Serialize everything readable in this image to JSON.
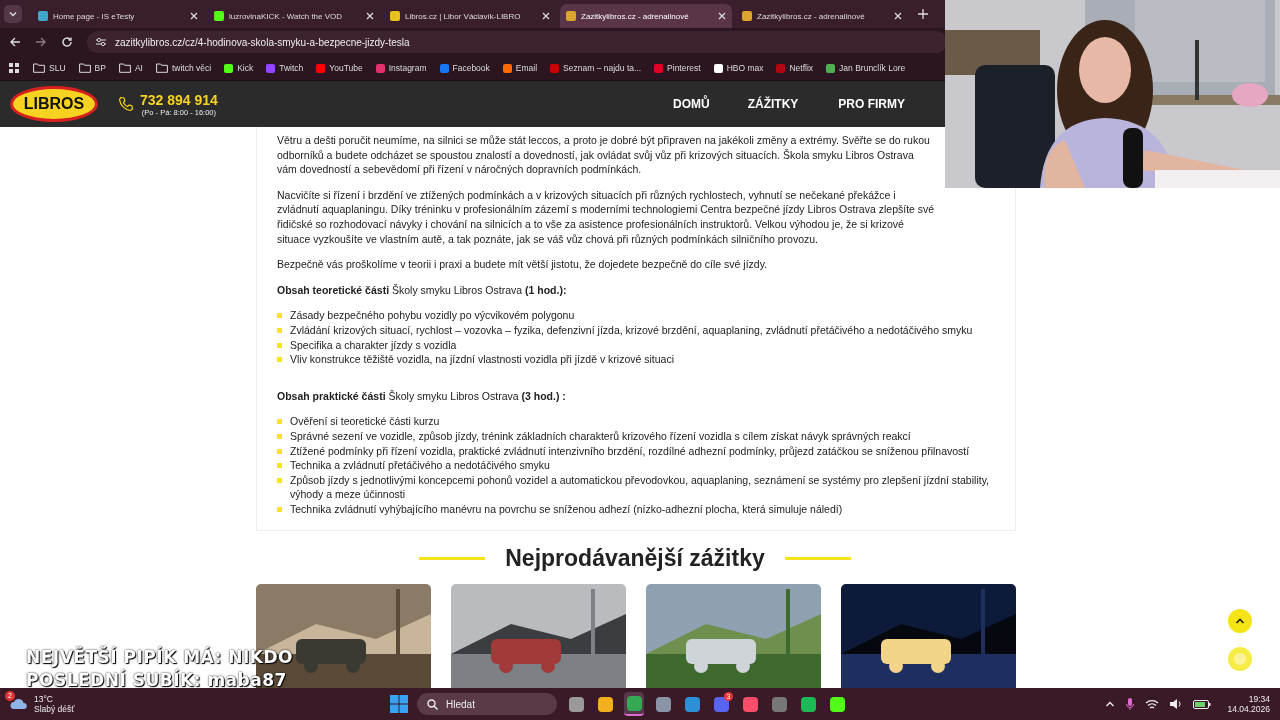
{
  "tabs": [
    {
      "title": "Home page - IS eTesty",
      "selected": false,
      "color": "#3fa7c9"
    },
    {
      "title": "luzrovinaKICK - Watch the VOD",
      "selected": false,
      "color": "#53fc18"
    },
    {
      "title": "Libros.cz | Libor Václavík-LIBRO",
      "selected": false,
      "color": "#e8c21c"
    },
    {
      "title": "Zazitkylibros.cz - adrenalinové",
      "selected": true,
      "color": "#d9a52a"
    },
    {
      "title": "Zazitkylibros.cz - adrenalinové",
      "selected": false,
      "color": "#d9a52a"
    }
  ],
  "address": {
    "url": "zazitkylibros.cz/cz/4-hodinova-skola-smyku-a-bezpecne-jizdy-tesla"
  },
  "bookmarks": [
    {
      "label": "SLU",
      "kind": "folder"
    },
    {
      "label": "BP",
      "kind": "folder"
    },
    {
      "label": "AI",
      "kind": "folder"
    },
    {
      "label": "twitch věci",
      "kind": "folder"
    },
    {
      "label": "Kick",
      "kind": "site",
      "color": "#53fc18"
    },
    {
      "label": "Twitch",
      "kind": "site",
      "color": "#9146ff"
    },
    {
      "label": "YouTube",
      "kind": "site",
      "color": "#ff0000"
    },
    {
      "label": "Instagram",
      "kind": "site",
      "color": "#e1306c"
    },
    {
      "label": "Facebook",
      "kind": "site",
      "color": "#1877f2"
    },
    {
      "label": "Email",
      "kind": "site",
      "color": "#ff6a00"
    },
    {
      "label": "Seznam – najdu ta...",
      "kind": "site",
      "color": "#cc0000"
    },
    {
      "label": "Pinterest",
      "kind": "site",
      "color": "#e60023"
    },
    {
      "label": "HBO max",
      "kind": "site",
      "color": "#ffffff"
    },
    {
      "label": "Netflix",
      "kind": "site",
      "color": "#b20710"
    },
    {
      "label": "Jan Brunclík Lore",
      "kind": "site",
      "color": "#4caf50"
    }
  ],
  "header": {
    "logo": "LIBROS",
    "phone": "732 894 914",
    "hours": "(Po - Pá: 8:00 - 16:00)",
    "nav": [
      "DOMŮ",
      "ZÁŽITKY",
      "PRO FIRMY"
    ]
  },
  "article": {
    "paragraphs": [
      "Větru a dešti poručit neumíme, na silnici se může stát leccos, a proto je dobré být připraven na jakékoli změny a extrémy. Svěřte se do rukou odborníků a budete odcházet se spoustou znalostí a dovedností, jak ovládat svůj vůz při krizových situacích. Škola smyku Libros Ostrava vám dovedností a sebevědomí při řízení v náročných dopravních podmínkách.",
      "Nacvičíte si řízení i brzdění ve ztížených podmínkách a v krizových situacích při různých rychlostech, vyhnutí se nečekané překážce i zvládnutí aquaplaningu. Díky tréninku v profesionálním zázemí s moderními technologiemi Centra bezpečné jízdy Libros Ostrava zlepšíte své řidičské so rozhodovací návyky i chování na silnicích a to vše za asistence profesionálních instruktorů. Velkou výhodou je, že si krizové situace vyzkoušíte ve vlastním autě, a tak poznáte, jak se váš vůz chová při různých podmínkách silničního provozu.",
      "Bezpečně vás proškolíme v teorii i praxi a budete mít větší jistotu, že dojedete bezpečně do cíle své jízdy."
    ],
    "sections": [
      {
        "heading": "**Obsah teoretické části** Školy smyku Libros Ostrava **(1 hod.):**",
        "items": [
          "Zásady bezpečného pohybu vozidly po výcvikovém polygonu",
          "Zvládání krizových situací, rychlost – vozovka – fyzika, defenzivní jízda, krizové brzdění, aquaplaning, zvládnutí přetáčivého a nedotáčivého smyku",
          "Specifika a charakter jízdy s vozidla",
          "Vliv konstrukce těžiště vozidla, na jízdní vlastnosti vozidla při jízdě v krizové situaci"
        ]
      },
      {
        "heading": "**Obsah praktické části** Školy smyku Libros Ostrava **(3 hod.) :**",
        "items": [
          "Ověření si teoretické části kurzu",
          "Správné sezení ve vozidle, způsob jízdy, trénink základních charakterů krizového řízení vozidla s cílem získat návyk správných reakcí",
          "Ztížené podmínky při řízení vozidla, praktické zvládnutí intenzivního brzdění, rozdílné adhezní podmínky, průjezd zatáčkou se sníženou přilnavostí",
          "Technika a zvládnutí přetáčivého a nedotáčivého smyku",
          "Způsob jízdy s jednotlivými koncepcemi pohonů vozidel a automatickou převodovkou, aquaplaning, seznámení se systémy pro zlepšení jízdní stability, výhody a meze účinnosti",
          "Technika zvládnutí vyhýbajícího manévru na povrchu se sníženou adhezí (nízko-adhezní plocha, která simuluje náledí)"
        ]
      }
    ]
  },
  "bestsellers": {
    "title": "Nejprodávanější zážitky"
  },
  "stream_overlay": [
    "NEJVĚTŠÍ PIPÍK MÁ: NIKDO",
    "POSLEDNÍ SUBÍK: maba87"
  ],
  "taskbar": {
    "weather": {
      "badge": "2",
      "temp": "13°C",
      "condition": "Slabý déšť"
    },
    "search": {
      "placeholder": "Hledat"
    },
    "apps": [
      {
        "color": "#9a9a9a",
        "selected": false
      },
      {
        "color": "#f2b01e",
        "selected": false
      },
      {
        "color": "#34a853",
        "selected": true
      },
      {
        "color": "#8a94a6",
        "selected": false
      },
      {
        "color": "#2d8fd5",
        "selected": false
      },
      {
        "color": "#5865f2",
        "selected": false,
        "badge": "3"
      },
      {
        "color": "#fa4d6a",
        "selected": false
      },
      {
        "color": "#777777",
        "selected": false
      },
      {
        "color": "#1db954",
        "selected": false
      },
      {
        "color": "#53fc18",
        "selected": false
      }
    ],
    "time": "19:34",
    "date": "14.04.2026"
  }
}
